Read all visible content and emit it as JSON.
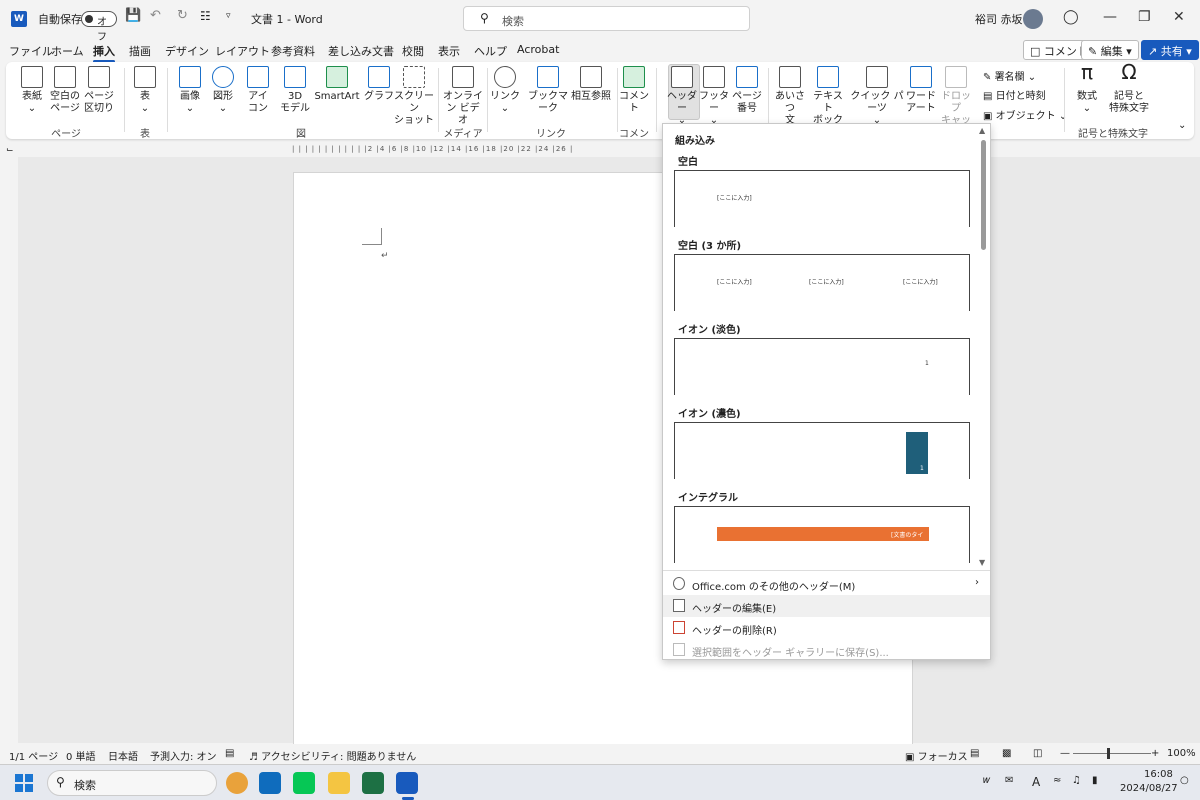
{
  "titlebar": {
    "autosave": "自動保存",
    "toggle_state": "オフ",
    "title": "文書 1 - Word",
    "search_placeholder": "検索",
    "user": "裕司 赤坂"
  },
  "tabs": [
    "ファイル",
    "ホーム",
    "挿入",
    "描画",
    "デザイン",
    "レイアウト",
    "参考資料",
    "差し込み文書",
    "校閲",
    "表示",
    "ヘルプ",
    "Acrobat"
  ],
  "right_buttons": {
    "comment": "コメント",
    "edit": "編集",
    "share": "共有"
  },
  "ribbon": {
    "pages": {
      "cover": "表紙",
      "blank1": "空白の",
      "blank2": "ページ",
      "break1": "ページ",
      "break2": "区切り",
      "label": "ページ"
    },
    "tables": {
      "table": "表",
      "label": "表"
    },
    "illust": {
      "image": "画像",
      "shape": "図形",
      "icon1": "アイ",
      "icon2": "コン",
      "d3a": "3D",
      "d3b": "モデル",
      "smartart": "SmartArt",
      "graph": "グラフ",
      "screen1": "スクリーン",
      "screen2": "ショット",
      "label": "図"
    },
    "media": {
      "online1": "オンライ",
      "online2": "ン ビデオ",
      "label": "メディア"
    },
    "links": {
      "link": "リンク",
      "bookmark": "ブックマーク",
      "cross": "相互参照",
      "label": "リンク"
    },
    "comments": {
      "comment": "コメント",
      "label": "コメント"
    },
    "hf": {
      "header": "ヘッダー",
      "footer": "フッター",
      "pagenum1": "ページ",
      "pagenum2": "番号"
    },
    "text": {
      "greet1": "あいさつ",
      "greet2": "文",
      "textbox1": "テキスト",
      "textbox2": "ボックス",
      "quick": "クイック パーツ",
      "wordart1": "ワード",
      "wordart2": "アート",
      "drop1": "ドロップ",
      "drop2": "キャップ",
      "sig": "署名欄",
      "date": "日付と時刻",
      "object": "オブジェクト"
    },
    "symbols": {
      "eq": "数式",
      "sym1": "記号と",
      "sym2": "特殊文字",
      "label": "記号と特殊文字"
    }
  },
  "ruler": "| | | | | | | | | | | |2 |4 |6 |8 |10 |12 |14 |16 |18 |20 |22 |24 |26 |",
  "dropdown": {
    "section": "組み込み",
    "items": [
      {
        "name": "空白",
        "placeholders": [
          "[ここに入力]"
        ]
      },
      {
        "name": "空白 (3 か所)",
        "placeholders": [
          "[ここに入力]",
          "[ここに入力]",
          "[ここに入力]"
        ]
      },
      {
        "name": "イオン (淡色)",
        "placeholders": [
          "1"
        ]
      },
      {
        "name": "イオン (濃色)",
        "placeholders": [
          "1"
        ]
      },
      {
        "name": "インテグラル",
        "placeholders": [
          "[文書のタイトル]"
        ]
      }
    ],
    "menu": {
      "more": "Office.com のその他のヘッダー(M)",
      "edit": "ヘッダーの編集(E)",
      "delete": "ヘッダーの削除(R)",
      "save": "選択範囲をヘッダー ギャラリーに保存(S)..."
    }
  },
  "status": {
    "page": "1/1 ページ",
    "words": "0 単語",
    "lang": "日本語",
    "ime": "予測入力: オン",
    "access": "アクセシビリティ: 問題ありません",
    "focus": "フォーカス",
    "zoom": "100%"
  },
  "taskbar": {
    "search": "検索",
    "time": "16:08",
    "date": "2024/08/27"
  },
  "colors": {
    "accent": "#185abd",
    "ion_dark": "#1f5f7a",
    "integral": "#e97132"
  }
}
